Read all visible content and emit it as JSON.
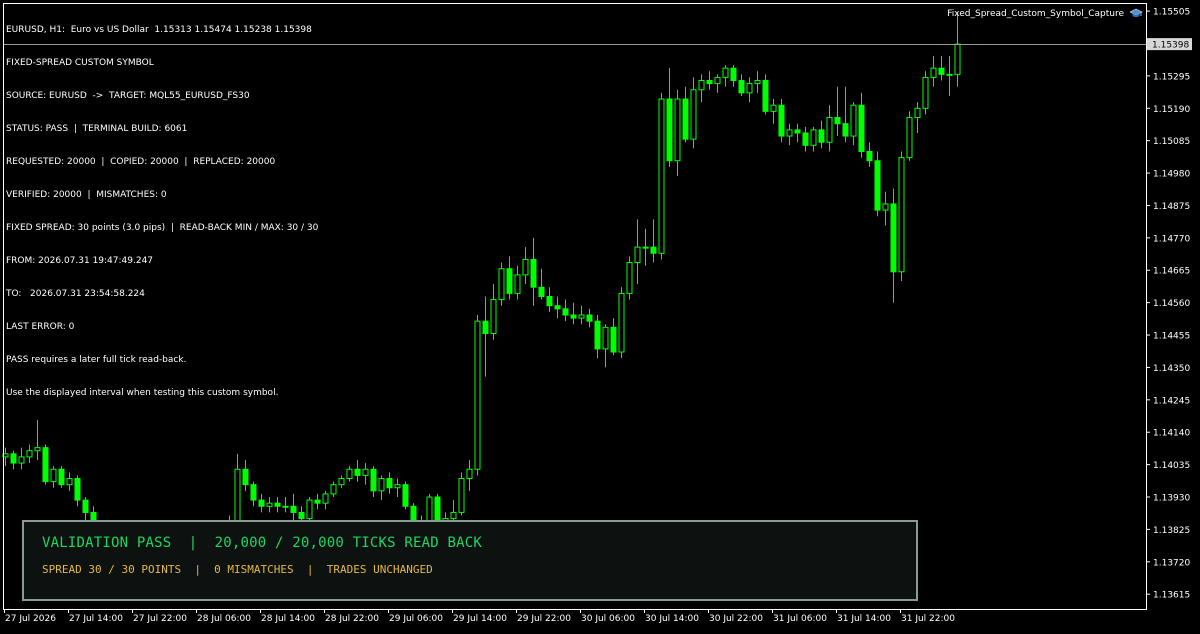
{
  "chart_data": {
    "type": "candlestick",
    "symbol": "EURUSD",
    "timeframe": "H1",
    "x": [
      "27 Jul 2026",
      "27 Jul 14:00",
      "27 Jul 22:00",
      "28 Jul 06:00",
      "28 Jul 14:00",
      "28 Jul 22:00",
      "29 Jul 06:00",
      "29 Jul 14:00",
      "29 Jul 22:00",
      "30 Jul 06:00",
      "30 Jul 14:00",
      "30 Jul 22:00",
      "31 Jul 06:00",
      "31 Jul 14:00",
      "31 Jul 22:00"
    ],
    "ylim": [
      1.13567,
      1.15528
    ],
    "y_ticks": [
      "1.15505",
      "1.15400",
      "1.15295",
      "1.15190",
      "1.15085",
      "1.14980",
      "1.14875",
      "1.14770",
      "1.14665",
      "1.14560",
      "1.14455",
      "1.14350",
      "1.14245",
      "1.14140",
      "1.14035",
      "1.13930",
      "1.13825",
      "1.13720",
      "1.13615"
    ],
    "current_price": 1.15398,
    "current_price_label": "1.15398",
    "grid": false,
    "colors": {
      "up": "#00ff00",
      "down": "#00ff00",
      "background": "#000000",
      "axis": "#ffffff",
      "price_line": "#9a9a9a"
    },
    "candles": [
      {
        "o": 1.1406,
        "h": 1.1409,
        "l": 1.1403,
        "c": 1.1407
      },
      {
        "o": 1.1407,
        "h": 1.1408,
        "l": 1.1402,
        "c": 1.1404
      },
      {
        "o": 1.1404,
        "h": 1.1409,
        "l": 1.1402,
        "c": 1.1406
      },
      {
        "o": 1.1406,
        "h": 1.141,
        "l": 1.1404,
        "c": 1.1408
      },
      {
        "o": 1.1408,
        "h": 1.1418,
        "l": 1.1405,
        "c": 1.1409
      },
      {
        "o": 1.1409,
        "h": 1.141,
        "l": 1.1397,
        "c": 1.1398
      },
      {
        "o": 1.1398,
        "h": 1.1403,
        "l": 1.1396,
        "c": 1.1402
      },
      {
        "o": 1.1402,
        "h": 1.1403,
        "l": 1.1396,
        "c": 1.1397
      },
      {
        "o": 1.1397,
        "h": 1.1401,
        "l": 1.1395,
        "c": 1.1399
      },
      {
        "o": 1.1399,
        "h": 1.14,
        "l": 1.139,
        "c": 1.1392
      },
      {
        "o": 1.1392,
        "h": 1.1393,
        "l": 1.1385,
        "c": 1.1388
      },
      {
        "o": 1.1388,
        "h": 1.139,
        "l": 1.1381,
        "c": 1.1383
      },
      {
        "o": 1.1383,
        "h": 1.1385,
        "l": 1.1379,
        "c": 1.1381
      },
      {
        "o": 1.1381,
        "h": 1.1384,
        "l": 1.1378,
        "c": 1.1382
      },
      {
        "o": 1.1382,
        "h": 1.1384,
        "l": 1.1377,
        "c": 1.1379
      },
      {
        "o": 1.1379,
        "h": 1.1383,
        "l": 1.1377,
        "c": 1.1381
      },
      {
        "o": 1.1381,
        "h": 1.1383,
        "l": 1.1376,
        "c": 1.1378
      },
      {
        "o": 1.1378,
        "h": 1.1382,
        "l": 1.1376,
        "c": 1.138
      },
      {
        "o": 1.138,
        "h": 1.1381,
        "l": 1.1374,
        "c": 1.1376
      },
      {
        "o": 1.1376,
        "h": 1.138,
        "l": 1.1374,
        "c": 1.1378
      },
      {
        "o": 1.1378,
        "h": 1.1379,
        "l": 1.1373,
        "c": 1.1375
      },
      {
        "o": 1.1375,
        "h": 1.1379,
        "l": 1.1373,
        "c": 1.1377
      },
      {
        "o": 1.1377,
        "h": 1.1379,
        "l": 1.1372,
        "c": 1.1374
      },
      {
        "o": 1.1374,
        "h": 1.1378,
        "l": 1.1372,
        "c": 1.1376
      },
      {
        "o": 1.1376,
        "h": 1.1378,
        "l": 1.1371,
        "c": 1.1373
      },
      {
        "o": 1.1373,
        "h": 1.1377,
        "l": 1.1371,
        "c": 1.1375
      },
      {
        "o": 1.1375,
        "h": 1.1377,
        "l": 1.1371,
        "c": 1.1373
      },
      {
        "o": 1.1373,
        "h": 1.1377,
        "l": 1.1371,
        "c": 1.1376
      },
      {
        "o": 1.1376,
        "h": 1.1387,
        "l": 1.1374,
        "c": 1.1385
      },
      {
        "o": 1.1385,
        "h": 1.1407,
        "l": 1.1384,
        "c": 1.1402
      },
      {
        "o": 1.1402,
        "h": 1.1405,
        "l": 1.1395,
        "c": 1.1397
      },
      {
        "o": 1.1397,
        "h": 1.1398,
        "l": 1.139,
        "c": 1.1392
      },
      {
        "o": 1.1392,
        "h": 1.1394,
        "l": 1.1388,
        "c": 1.139
      },
      {
        "o": 1.139,
        "h": 1.1393,
        "l": 1.1388,
        "c": 1.1391
      },
      {
        "o": 1.1391,
        "h": 1.1393,
        "l": 1.1388,
        "c": 1.139
      },
      {
        "o": 1.139,
        "h": 1.1393,
        "l": 1.1388,
        "c": 1.139
      },
      {
        "o": 1.139,
        "h": 1.1394,
        "l": 1.1385,
        "c": 1.1388
      },
      {
        "o": 1.1388,
        "h": 1.139,
        "l": 1.1384,
        "c": 1.1386
      },
      {
        "o": 1.1386,
        "h": 1.1393,
        "l": 1.1385,
        "c": 1.1392
      },
      {
        "o": 1.1392,
        "h": 1.1394,
        "l": 1.1389,
        "c": 1.1391
      },
      {
        "o": 1.1391,
        "h": 1.1395,
        "l": 1.1389,
        "c": 1.1394
      },
      {
        "o": 1.1394,
        "h": 1.1398,
        "l": 1.1393,
        "c": 1.1397
      },
      {
        "o": 1.1397,
        "h": 1.14,
        "l": 1.1396,
        "c": 1.1399
      },
      {
        "o": 1.1399,
        "h": 1.1403,
        "l": 1.1398,
        "c": 1.1402
      },
      {
        "o": 1.1402,
        "h": 1.1405,
        "l": 1.1398,
        "c": 1.14
      },
      {
        "o": 1.14,
        "h": 1.1404,
        "l": 1.1397,
        "c": 1.1402
      },
      {
        "o": 1.1402,
        "h": 1.1403,
        "l": 1.1393,
        "c": 1.1395
      },
      {
        "o": 1.1395,
        "h": 1.14,
        "l": 1.1392,
        "c": 1.1399
      },
      {
        "o": 1.1399,
        "h": 1.1401,
        "l": 1.1394,
        "c": 1.1396
      },
      {
        "o": 1.1396,
        "h": 1.1399,
        "l": 1.1393,
        "c": 1.1397
      },
      {
        "o": 1.1397,
        "h": 1.1398,
        "l": 1.1389,
        "c": 1.139
      },
      {
        "o": 1.139,
        "h": 1.1391,
        "l": 1.1383,
        "c": 1.1385
      },
      {
        "o": 1.1385,
        "h": 1.1387,
        "l": 1.138,
        "c": 1.1382
      },
      {
        "o": 1.1382,
        "h": 1.1394,
        "l": 1.1381,
        "c": 1.1393
      },
      {
        "o": 1.1393,
        "h": 1.1394,
        "l": 1.1383,
        "c": 1.1385
      },
      {
        "o": 1.1385,
        "h": 1.1388,
        "l": 1.1382,
        "c": 1.1386
      },
      {
        "o": 1.1386,
        "h": 1.1392,
        "l": 1.1384,
        "c": 1.1388
      },
      {
        "o": 1.1388,
        "h": 1.1401,
        "l": 1.1387,
        "c": 1.1399
      },
      {
        "o": 1.1399,
        "h": 1.1405,
        "l": 1.1395,
        "c": 1.1402
      },
      {
        "o": 1.1402,
        "h": 1.1452,
        "l": 1.14,
        "c": 1.145
      },
      {
        "o": 1.145,
        "h": 1.1458,
        "l": 1.1432,
        "c": 1.1446
      },
      {
        "o": 1.1446,
        "h": 1.1462,
        "l": 1.1444,
        "c": 1.1457
      },
      {
        "o": 1.1457,
        "h": 1.1469,
        "l": 1.1455,
        "c": 1.1467
      },
      {
        "o": 1.1467,
        "h": 1.1471,
        "l": 1.1457,
        "c": 1.1459
      },
      {
        "o": 1.1459,
        "h": 1.1468,
        "l": 1.1457,
        "c": 1.1465
      },
      {
        "o": 1.1465,
        "h": 1.1474,
        "l": 1.1462,
        "c": 1.147
      },
      {
        "o": 1.147,
        "h": 1.1477,
        "l": 1.1455,
        "c": 1.1461
      },
      {
        "o": 1.1461,
        "h": 1.1467,
        "l": 1.1457,
        "c": 1.1458
      },
      {
        "o": 1.1458,
        "h": 1.1461,
        "l": 1.1453,
        "c": 1.1455
      },
      {
        "o": 1.1455,
        "h": 1.1458,
        "l": 1.1451,
        "c": 1.1454
      },
      {
        "o": 1.1454,
        "h": 1.1457,
        "l": 1.145,
        "c": 1.1452
      },
      {
        "o": 1.1452,
        "h": 1.1456,
        "l": 1.1449,
        "c": 1.1451
      },
      {
        "o": 1.1451,
        "h": 1.1455,
        "l": 1.1449,
        "c": 1.1452
      },
      {
        "o": 1.1452,
        "h": 1.1454,
        "l": 1.1448,
        "c": 1.145
      },
      {
        "o": 1.145,
        "h": 1.1452,
        "l": 1.1438,
        "c": 1.1441
      },
      {
        "o": 1.1441,
        "h": 1.1449,
        "l": 1.1435,
        "c": 1.1448
      },
      {
        "o": 1.1448,
        "h": 1.1451,
        "l": 1.1439,
        "c": 1.144
      },
      {
        "o": 1.144,
        "h": 1.1461,
        "l": 1.1438,
        "c": 1.1459
      },
      {
        "o": 1.1459,
        "h": 1.1471,
        "l": 1.1457,
        "c": 1.1469
      },
      {
        "o": 1.1469,
        "h": 1.1483,
        "l": 1.1462,
        "c": 1.1474
      },
      {
        "o": 1.1474,
        "h": 1.148,
        "l": 1.1468,
        "c": 1.1474
      },
      {
        "o": 1.1474,
        "h": 1.1483,
        "l": 1.1469,
        "c": 1.1472
      },
      {
        "o": 1.1472,
        "h": 1.1524,
        "l": 1.147,
        "c": 1.1522
      },
      {
        "o": 1.1522,
        "h": 1.1532,
        "l": 1.15,
        "c": 1.1502
      },
      {
        "o": 1.1502,
        "h": 1.1525,
        "l": 1.1497,
        "c": 1.1522
      },
      {
        "o": 1.1522,
        "h": 1.1526,
        "l": 1.1508,
        "c": 1.1509
      },
      {
        "o": 1.1509,
        "h": 1.1529,
        "l": 1.1506,
        "c": 1.1525
      },
      {
        "o": 1.1525,
        "h": 1.153,
        "l": 1.1521,
        "c": 1.1528
      },
      {
        "o": 1.1528,
        "h": 1.1531,
        "l": 1.1525,
        "c": 1.1527
      },
      {
        "o": 1.1527,
        "h": 1.153,
        "l": 1.1524,
        "c": 1.1529
      },
      {
        "o": 1.1529,
        "h": 1.1533,
        "l": 1.1526,
        "c": 1.1532
      },
      {
        "o": 1.1532,
        "h": 1.1533,
        "l": 1.1526,
        "c": 1.1528
      },
      {
        "o": 1.1528,
        "h": 1.153,
        "l": 1.1523,
        "c": 1.1524
      },
      {
        "o": 1.1524,
        "h": 1.1529,
        "l": 1.1521,
        "c": 1.1527
      },
      {
        "o": 1.1527,
        "h": 1.1531,
        "l": 1.1524,
        "c": 1.1528
      },
      {
        "o": 1.1528,
        "h": 1.153,
        "l": 1.1517,
        "c": 1.1518
      },
      {
        "o": 1.1518,
        "h": 1.1522,
        "l": 1.1514,
        "c": 1.152
      },
      {
        "o": 1.152,
        "h": 1.1522,
        "l": 1.1508,
        "c": 1.151
      },
      {
        "o": 1.151,
        "h": 1.1514,
        "l": 1.1507,
        "c": 1.1512
      },
      {
        "o": 1.1512,
        "h": 1.1514,
        "l": 1.1508,
        "c": 1.1511
      },
      {
        "o": 1.1511,
        "h": 1.1513,
        "l": 1.1505,
        "c": 1.1507
      },
      {
        "o": 1.1507,
        "h": 1.1513,
        "l": 1.1505,
        "c": 1.1512
      },
      {
        "o": 1.1512,
        "h": 1.1515,
        "l": 1.1506,
        "c": 1.1508
      },
      {
        "o": 1.1508,
        "h": 1.152,
        "l": 1.1505,
        "c": 1.1516
      },
      {
        "o": 1.1516,
        "h": 1.1526,
        "l": 1.151,
        "c": 1.1514
      },
      {
        "o": 1.1514,
        "h": 1.1526,
        "l": 1.1508,
        "c": 1.151
      },
      {
        "o": 1.151,
        "h": 1.1521,
        "l": 1.1507,
        "c": 1.152
      },
      {
        "o": 1.152,
        "h": 1.1524,
        "l": 1.1503,
        "c": 1.1505
      },
      {
        "o": 1.1505,
        "h": 1.1508,
        "l": 1.15,
        "c": 1.1502
      },
      {
        "o": 1.1502,
        "h": 1.1505,
        "l": 1.1484,
        "c": 1.1486
      },
      {
        "o": 1.1486,
        "h": 1.1492,
        "l": 1.1481,
        "c": 1.1488
      },
      {
        "o": 1.1488,
        "h": 1.1493,
        "l": 1.1456,
        "c": 1.1466
      },
      {
        "o": 1.1466,
        "h": 1.1505,
        "l": 1.1463,
        "c": 1.1503
      },
      {
        "o": 1.1503,
        "h": 1.1518,
        "l": 1.1502,
        "c": 1.1516
      },
      {
        "o": 1.1516,
        "h": 1.1521,
        "l": 1.1511,
        "c": 1.1519
      },
      {
        "o": 1.1519,
        "h": 1.1531,
        "l": 1.1517,
        "c": 1.1529
      },
      {
        "o": 1.1529,
        "h": 1.1536,
        "l": 1.1526,
        "c": 1.1532
      },
      {
        "o": 1.1532,
        "h": 1.1536,
        "l": 1.1528,
        "c": 1.153
      },
      {
        "o": 1.153,
        "h": 1.1536,
        "l": 1.1523,
        "c": 1.153
      },
      {
        "o": 1.153,
        "h": 1.155,
        "l": 1.1526,
        "c": 1.15398
      }
    ]
  },
  "info": {
    "lines": [
      "EURUSD, H1:  Euro vs US Dollar  1.15313 1.15474 1.15238 1.15398",
      "FIXED-SPREAD CUSTOM SYMBOL",
      "SOURCE: EURUSD  ->  TARGET: MQL55_EURUSD_FS30",
      "STATUS: PASS  |  TERMINAL BUILD: 6061",
      "REQUESTED: 20000  |  COPIED: 20000  |  REPLACED: 20000",
      "VERIFIED: 20000  |  MISMATCHES: 0",
      "FIXED SPREAD: 30 points (3.0 pips)  |  READ-BACK MIN / MAX: 30 / 30",
      "FROM: 2026.07.31 19:47:49.247",
      "TO:   2026.07.31 23:54:58.224",
      "LAST ERROR: 0",
      "PASS requires a later full tick read-back.",
      "Use the displayed interval when testing this custom symbol."
    ]
  },
  "indicator": {
    "name": "Fixed_Spread_Custom_Symbol_Capture",
    "icon": "graduation-cap-icon"
  },
  "panel": {
    "title": "VALIDATION PASS  |  20,000 / 20,000 TICKS READ BACK",
    "subtitle": "SPREAD 30 / 30 POINTS  |  0 MISMATCHES  |  TRADES UNCHANGED",
    "title_color": "#18d860",
    "subtitle_color": "#e3b845"
  }
}
